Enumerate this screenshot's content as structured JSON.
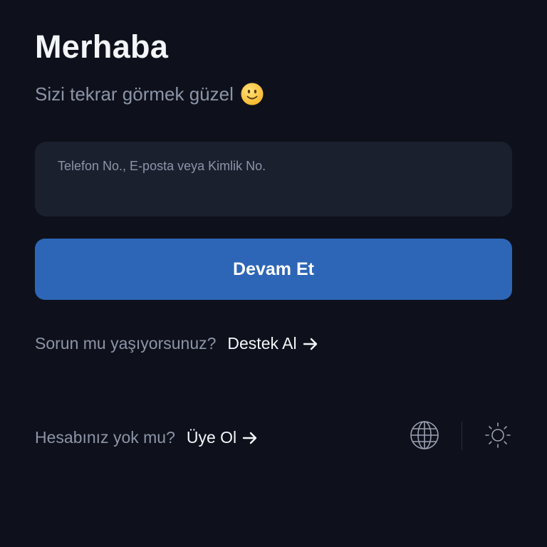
{
  "header": {
    "title": "Merhaba",
    "subtitle": "Sizi tekrar görmek güzel"
  },
  "login": {
    "input_placeholder": "Telefon No., E-posta veya Kimlik No.",
    "input_value": "",
    "continue_label": "Devam Et"
  },
  "support": {
    "question": "Sorun mu yaşıyorsunuz?",
    "link_label": "Destek Al"
  },
  "signup": {
    "question": "Hesabınız yok mu?",
    "link_label": "Üye Ol"
  },
  "icons": {
    "emoji": "slightly-smiling-face-icon",
    "arrow": "arrow-right-icon",
    "language": "globe-icon",
    "theme": "sun-icon"
  },
  "colors": {
    "background": "#0e111b",
    "input_background": "#1a202e",
    "primary": "#2d66b6",
    "text": "#f3f5f8",
    "muted": "#8c94a7"
  }
}
